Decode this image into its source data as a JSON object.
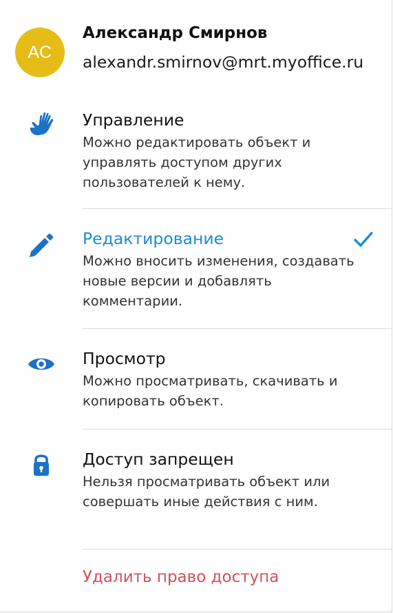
{
  "user": {
    "initials": "АС",
    "name": "Александр Смирнов",
    "email": "alexandr.smirnov@mrt.myoffice.ru",
    "avatar_color": "#e6bd17"
  },
  "options": [
    {
      "icon": "hand-icon",
      "title": "Управление",
      "description": "Можно редактировать объект и управлять доступом других пользователей к нему.",
      "selected": false
    },
    {
      "icon": "pencil-icon",
      "title": "Редактирование",
      "description": "Можно вносить изменения, создавать новые версии и добавлять комментарии.",
      "selected": true
    },
    {
      "icon": "eye-icon",
      "title": "Просмотр",
      "description": "Можно просматривать, скачивать и копировать объект.",
      "selected": false
    },
    {
      "icon": "lock-icon",
      "title": "Доступ запрещен",
      "description": "Нельзя просматривать объект или совершать иные действия с ним.",
      "selected": false
    }
  ],
  "remove_label": "Удалить право доступа",
  "colors": {
    "accent": "#1c8bd1",
    "danger": "#d0525a",
    "icon": "#1a73c7"
  }
}
